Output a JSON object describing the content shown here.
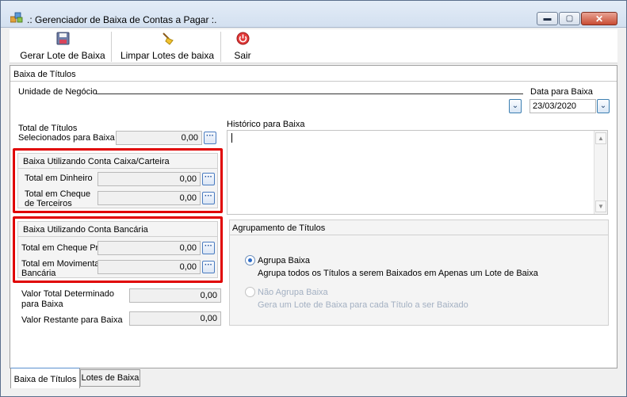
{
  "window": {
    "title": ".: Gerenciador de Baixa de Contas a Pagar :."
  },
  "window_controls": {
    "minimize": "▬",
    "maximize": "▢",
    "close": "✕"
  },
  "toolbar": {
    "buttons": [
      {
        "label": "Gerar Lote de Baixa",
        "icon": "save-icon"
      },
      {
        "label": "Limpar Lotes de baixa",
        "icon": "broom-icon"
      },
      {
        "label": "Sair",
        "icon": "power-icon"
      }
    ]
  },
  "panel": {
    "title": "Baixa de Títulos",
    "unidade_label": "Unidade de Negócio",
    "unidade_value": "",
    "data_label": "Data para Baixa",
    "data_value": "23/03/2020",
    "total_titulos_label_1": "Total de Títulos",
    "total_titulos_label_2": "Selecionados para Baixa",
    "total_titulos_value": "0,00",
    "historico_label": "Histórico para Baixa",
    "historico_value": ""
  },
  "group_caixa": {
    "title": "Baixa Utilizando Conta Caixa/Carteira",
    "dinheiro_label": "Total em Dinheiro",
    "dinheiro_value": "0,00",
    "cheque_label_1": "Total em Cheque",
    "cheque_label_2": "de Terceiros",
    "cheque_value": "0,00"
  },
  "group_bancaria": {
    "title": "Baixa Utilizando Conta Bancária",
    "cheque_proprio_label": "Total em Cheque Próprio",
    "cheque_proprio_value": "0,00",
    "movimentacao_label_1": "Total em Movimentação",
    "movimentacao_label_2": "Bancária",
    "movimentacao_value": "0,00"
  },
  "totals": {
    "determinado_label_1": "Valor Total Determinado",
    "determinado_label_2": "para Baixa",
    "determinado_value": "0,00",
    "restante_label": "Valor Restante para Baixa",
    "restante_value": "0,00"
  },
  "agrupamento": {
    "title": "Agrupamento de Títulos",
    "options": [
      {
        "label": "Agrupa Baixa",
        "description": "Agrupa todos os Títulos a serem Baixados em Apenas um Lote de Baixa",
        "checked": true,
        "enabled": true
      },
      {
        "label": "Não Agrupa Baixa",
        "description": "Gera um Lote de Baixa para cada Título a ser Baixado",
        "checked": false,
        "enabled": false
      }
    ]
  },
  "tabs": [
    {
      "label": "Baixa de Títulos",
      "active": true
    },
    {
      "label": "Lotes de Baixa",
      "active": false
    }
  ],
  "dots_button_label": "···",
  "combo_arrow": "⌄",
  "scroll_up": "▲",
  "scroll_down": "▼",
  "colors": {
    "highlight_frame": "#e00000",
    "accent": "#2c6bc7"
  }
}
